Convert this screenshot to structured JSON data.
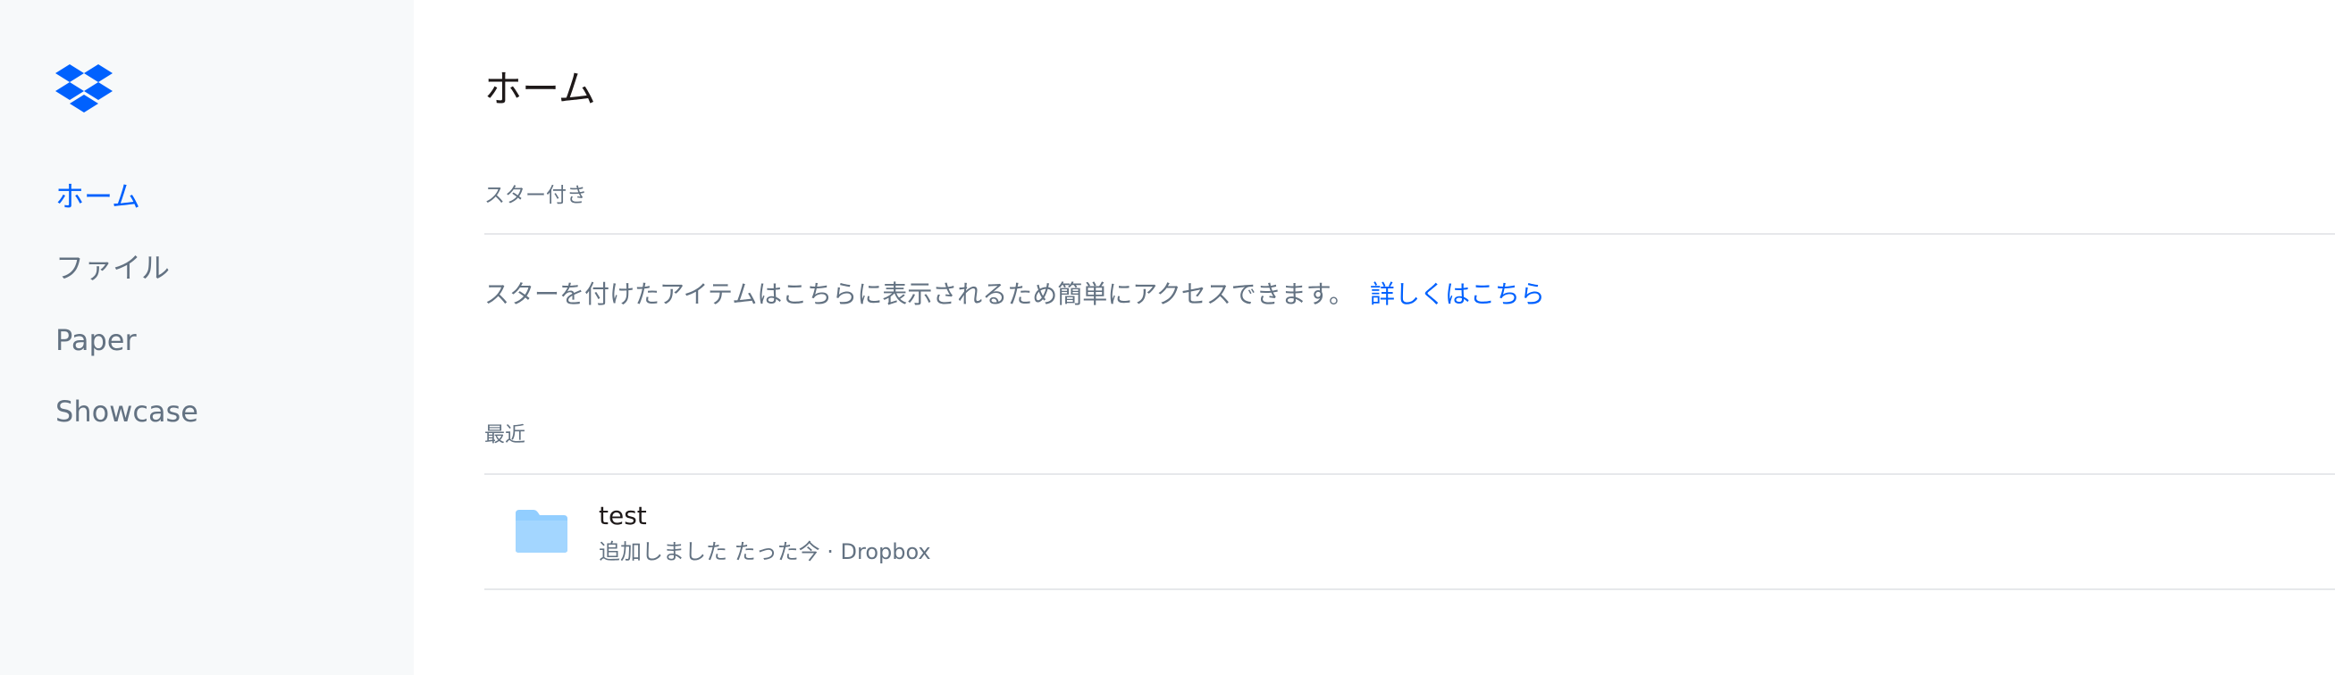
{
  "colors": {
    "accent": "#0061fe",
    "sidebar_bg": "#f7f9fa",
    "muted_text": "#637282",
    "divider": "#e6e8eb",
    "folder": "#92ceff"
  },
  "sidebar": {
    "logo_icon": "dropbox-logo",
    "items": [
      {
        "label": "ホーム",
        "active": true
      },
      {
        "label": "ファイル",
        "active": false
      },
      {
        "label": "Paper",
        "active": false
      },
      {
        "label": "Showcase",
        "active": false
      }
    ]
  },
  "main": {
    "title": "ホーム",
    "starred": {
      "label": "スター付き",
      "empty_message": "スターを付けたアイテムはこちらに表示されるため簡単にアクセスできます。",
      "learn_more": "詳しくはこちら"
    },
    "recent": {
      "label": "最近",
      "items": [
        {
          "icon": "folder-icon",
          "name": "test",
          "meta": "追加しました たった今 · Dropbox"
        }
      ]
    }
  }
}
